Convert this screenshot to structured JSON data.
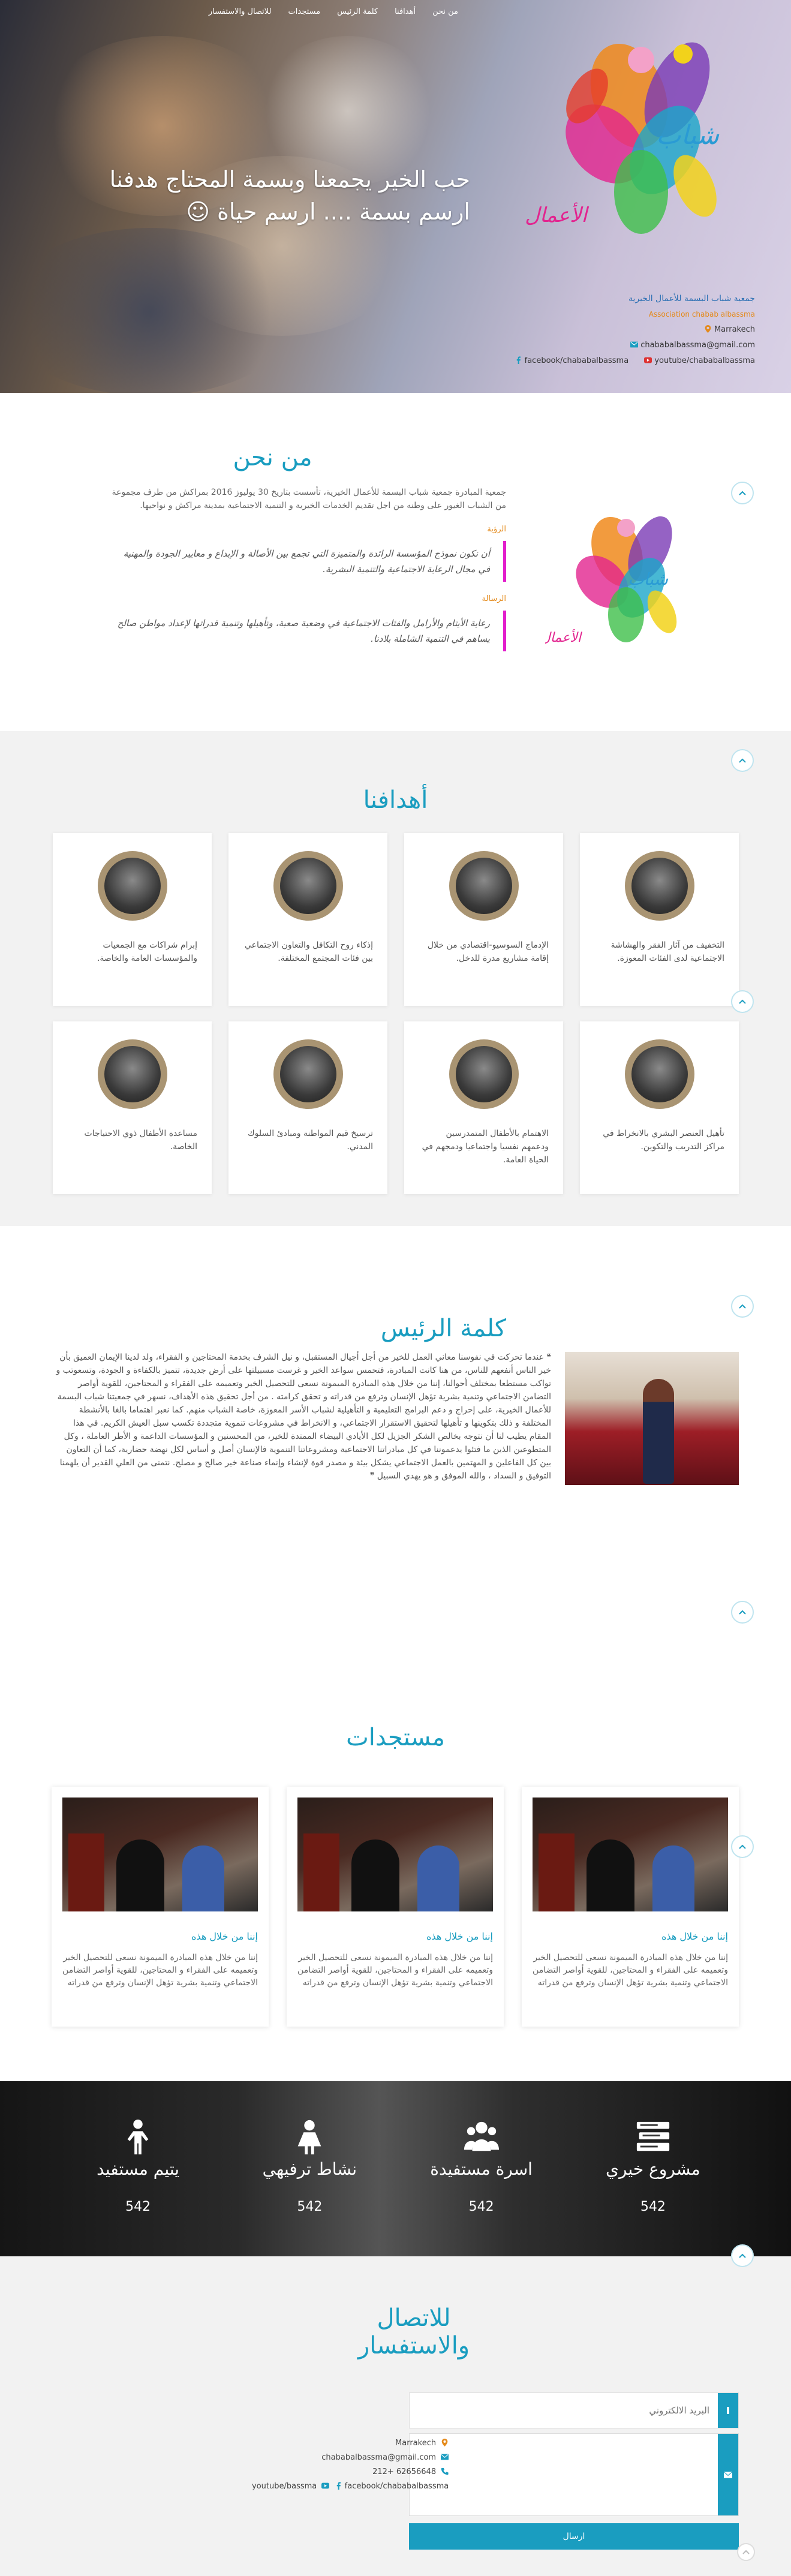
{
  "nav": {
    "items": [
      "من نحن",
      "أهدافنا",
      "كلمة الرئيس",
      "مستجدات",
      "للاتصال والاستفسار"
    ]
  },
  "hero": {
    "title_line1": "حب الخير يجمعنا وبسمة المحتاج هدفنا",
    "title_line2": "ارسم بسمة .... ارسم حياة ☺",
    "org_name_ar": "جمعية شباب البسمة للأعمال الخيرية",
    "org_name_fr": "Association chabab albassma",
    "city": "Marrakech",
    "email": "chababalbassma@gmail.com",
    "facebook": "facebook/chababalbassma",
    "youtube": "youtube/chababalbassma"
  },
  "about": {
    "title": "من نحن",
    "intro": "جمعية المبادرة جمعية شباب البسمة للأعمال الخيرية، تأسست بتاريخ 30 يوليوز 2016 بمراكش من طرف مجموعة من الشباب الغيور على وطنه من اجل تقديم الخدمات الخيرية و التنمية الاجتماعية بمدينة مراكش و نواحيها.",
    "vision_label": "الرؤية",
    "vision": "أن نكون نموذج المؤسسة الرائدة والمتميزة التي تجمع بين الأصالة و الإبداع و معايير الجودة والمهنية في مجال الرعاية الاجتماعية والتنمية البشرية.",
    "mission_label": "الرسالة",
    "mission": "رعاية الأيتام والأرامل والفئات الاجتماعية في وضعية صعبة، وتأهيلها وتنمية قدراتها لإعداد مواطن صالح يساهم في التنمية الشاملة بلادنا."
  },
  "goals": {
    "title": "أهدافنا",
    "items": [
      "التخفيف من آثار الفقر والهشاشة الاجتماعية لدى الفئات المعوزة.",
      "الإدماج السوسيو-اقتصادي من خلال إقامة مشاريع مدرة للدخل.",
      "إذكاء روح التكافل والتعاون الاجتماعي بين فئات المجتمع المختلفة.",
      "إبرام شراكات مع الجمعيات والمؤسسات العامة والخاصة.",
      "تأهيل العنصر البشري بالانخراط في مراكز التدريب والتكوين.",
      "الاهتمام بالأطفال المتمدرسين ودعمهم نفسيا واجتماعيا ودمجهم في الحياة العامة.",
      "ترسيخ قيم المواطنة ومبادئ السلوك المدني.",
      "مساعدة الأطفال ذوي الاحتياجات الخاصة."
    ]
  },
  "president": {
    "title": "كلمة الرئيس",
    "text": "❝ عندما تحركت في نفوسنا معاني العمل للخير من أجل أجيال المستقبل، و نيل الشرف بخدمة المحتاجين و الفقراء، ولد لدينا الإيمان العميق بأن خير الناس أنفعهم للناس، من هنا كانت المبادرة، فتحمس سواعد الخير و غرست مسبيلتها على أرض جديدة، تتميز بالكفاءة و الجودة، وتسعوتب و تواكب مستطعا بمختلف أحوالنا، إننا من خلال هذه المبادرة الميمونة نسعى للتحصيل الخير وتعميمه على الفقراء و المحتاجين، للقوية أواصر التضامن الاجتماعي وتنمية بشرية تؤهل الإنسان وترفع من قدراته و تحقق كرامته . من أجل تحقيق هذه الأهداف، نسهر في جمعيتنا شباب البسمة للأعمال الخيرية، على إحراج و دعم البرامج التعليمية و التأهيلية لشباب الأسر المعوزة، خاصة الشباب منهم. كما نعبر اهتماما بالغا بالأنشطة المختلفة و ذلك بتكوينها و تأهيلها لتحقيق الاستقرار الاجتماعي، و الانخراط في مشروعات تنموية متجددة تكسب سبل العيش الكريم. في هذا المقام يطيب لنا أن نتوجه بخالص الشكر الجزيل لكل الأيادي البيضاء الممتدة للخير، من المحسنين و المؤسسات الداعمة و الأطر العاملة ، وكل المتطوعين الذين ما فتئوا يدعموننا في كل مبادراتنا الاجتماعية ومشروعاتنا التنموية فالإنسان أصل و أساس لكل نهضة حضارية، كما أن التعاون بين كل الفاعلين و المهتمين بالعمل الاجتماعي يشكل بيئة و مصدر قوة لإنشاء وإنماء صناعة خير صالح و مصلح. نتمنى من العلي القدير أن يلهمنا التوفيق و السداد ، والله الموفق و هو يهدي السبيل ❞"
  },
  "projects": {
    "title": "مستجدات",
    "items": [
      {
        "title": "إننا من خلال هذه",
        "text": "إننا من خلال هذه المبادرة الميمونة نسعى للتحصيل الخير وتعميمه على الفقراء و المحتاجين، للقوية أواصر التضامن الاجتماعي وتنمية بشرية تؤهل الإنسان وترفع من قدراته"
      },
      {
        "title": "إننا من خلال هذه",
        "text": "إننا من خلال هذه المبادرة الميمونة نسعى للتحصيل الخير وتعميمه على الفقراء و المحتاجين، للقوية أواصر التضامن الاجتماعي وتنمية بشرية تؤهل الإنسان وترفع من قدراته"
      },
      {
        "title": "إننا من خلال هذه",
        "text": "إننا من خلال هذه المبادرة الميمونة نسعى للتحصيل الخير وتعميمه على الفقراء و المحتاجين، للقوية أواصر التضامن الاجتماعي وتنمية بشرية تؤهل الإنسان وترفع من قدراته"
      }
    ]
  },
  "stats": {
    "items": [
      {
        "label": "مشروع خيري",
        "value": "542",
        "icon": "books-icon"
      },
      {
        "label": "اسرة مستفيدة",
        "value": "542",
        "icon": "family-icon"
      },
      {
        "label": "نشاط ترفيهي",
        "value": "542",
        "icon": "girl-icon"
      },
      {
        "label": "يتيم مستفيد",
        "value": "542",
        "icon": "child-icon"
      }
    ]
  },
  "contact": {
    "title": "للاتصال والاستفسار",
    "email_placeholder": "البريد الالكتروني",
    "message_placeholder": "",
    "send_label": "ارسال",
    "city": "Marrakech",
    "email": "chababalbassma@gmail.com",
    "phone": "212+ 62656648",
    "facebook": "facebook/chababalbassma",
    "youtube": "youtube/bassma"
  },
  "colors": {
    "accent": "#1a9dc0",
    "vision_border": "#e21ecc",
    "label_orange": "#e48a1b"
  }
}
